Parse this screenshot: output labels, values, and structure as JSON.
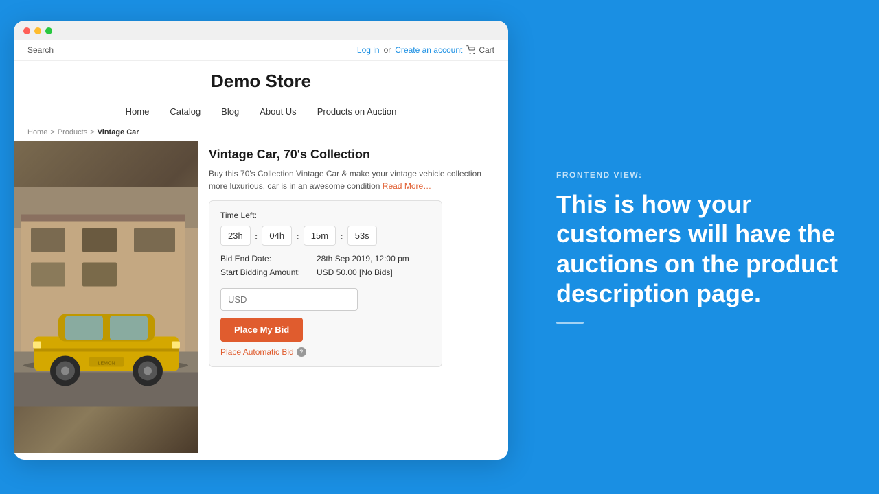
{
  "browser": {
    "dots": [
      "red",
      "yellow",
      "green"
    ]
  },
  "store": {
    "topbar": {
      "search_label": "Search",
      "login_label": "Log in",
      "or_label": "or",
      "create_account_label": "Create an account",
      "cart_label": "Cart"
    },
    "title": "Demo Store",
    "nav": {
      "items": [
        "Home",
        "Catalog",
        "Blog",
        "About Us",
        "Products on Auction"
      ]
    },
    "breadcrumb": {
      "home": "Home",
      "products": "Products",
      "current": "Vintage Car"
    },
    "product": {
      "title": "Vintage Car, 70's Collection",
      "description": "Buy this 70's Collection Vintage Car & make your vintage vehicle collection more luxurious, car is in an awesome condition",
      "read_more": "Read More…"
    },
    "auction": {
      "time_left_label": "Time Left:",
      "timer": {
        "hours1": "23h",
        "sep1": ":",
        "hours2": "04h",
        "sep2": ":",
        "minutes": "15m",
        "sep3": ":",
        "seconds": "53s"
      },
      "bid_end_label": "Bid End Date:",
      "bid_end_value": "28th Sep 2019, 12:00 pm",
      "start_bidding_label": "Start Bidding Amount:",
      "start_bidding_value": "USD 50.00  [No Bids]",
      "input_placeholder": "USD",
      "place_bid_button": "Place My Bid",
      "auto_bid_label": "Place Automatic Bid"
    }
  },
  "right_panel": {
    "frontend_label": "FRONTEND VIEW:",
    "headline": "This is how your customers will have the auctions on the product description page."
  }
}
